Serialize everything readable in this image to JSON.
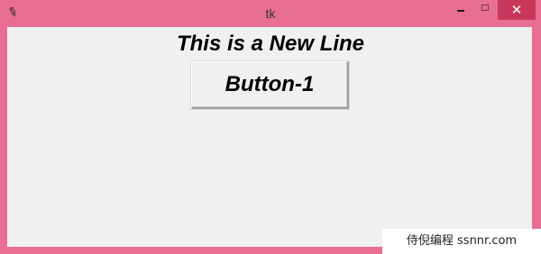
{
  "window": {
    "title": "tk",
    "icon": "feather-icon",
    "close_glyph": "✕",
    "colors": {
      "frame": "#e96e94",
      "close_button": "#c8385a",
      "client": "#f0f0f0"
    }
  },
  "content": {
    "label_text": "This is a New Line",
    "button_label": "Button-1"
  },
  "watermark": {
    "text": "侍倪编程 ssnnr.com"
  }
}
